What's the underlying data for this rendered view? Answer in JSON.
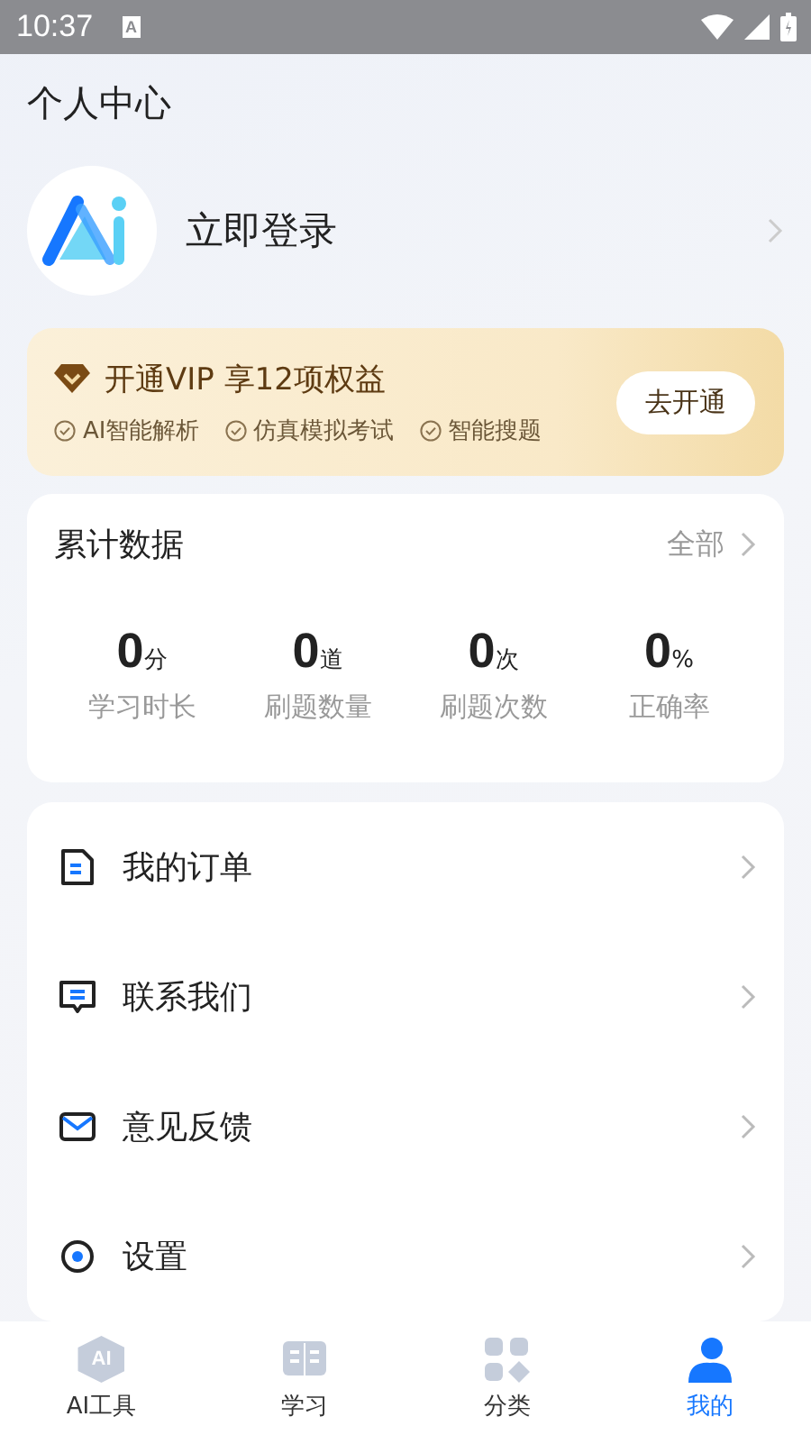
{
  "status_bar": {
    "time": "10:37",
    "notification": "A"
  },
  "header": {
    "title": "个人中心"
  },
  "profile": {
    "login_label": "立即登录"
  },
  "vip": {
    "title": "开通VIP 享12项权益",
    "benefits": [
      "AI智能解析",
      "仿真模拟考试",
      "智能搜题"
    ],
    "button": "去开通"
  },
  "stats": {
    "title": "累计数据",
    "more": "全部",
    "items": [
      {
        "value": "0",
        "unit": "分",
        "label": "学习时长"
      },
      {
        "value": "0",
        "unit": "道",
        "label": "刷题数量"
      },
      {
        "value": "0",
        "unit": "次",
        "label": "刷题次数"
      },
      {
        "value": "0",
        "unit": "%",
        "label": "正确率"
      }
    ]
  },
  "menu": [
    {
      "kind": "order",
      "label": "我的订单"
    },
    {
      "kind": "contact",
      "label": "联系我们"
    },
    {
      "kind": "feedback",
      "label": "意见反馈"
    },
    {
      "kind": "settings",
      "label": "设置"
    }
  ],
  "tabs": [
    {
      "kind": "ai",
      "icon_text": "AI",
      "label": "AI工具",
      "selected": false
    },
    {
      "kind": "study",
      "label": "学习",
      "selected": false
    },
    {
      "kind": "category",
      "label": "分类",
      "selected": false
    },
    {
      "kind": "me",
      "label": "我的",
      "selected": true
    }
  ]
}
